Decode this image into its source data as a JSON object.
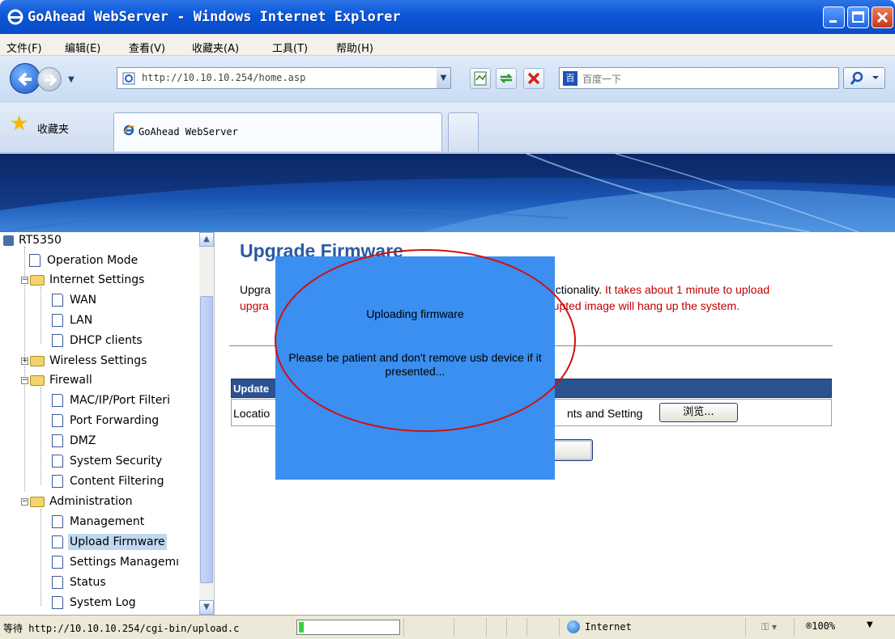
{
  "window": {
    "title": "GoAhead WebServer - Windows Internet Explorer"
  },
  "menubar": {
    "items": [
      "文件(F)",
      "编辑(E)",
      "查看(V)",
      "收藏夹(A)",
      "工具(T)",
      "帮助(H)"
    ]
  },
  "navbar": {
    "address": "http://10.10.10.254/home.asp",
    "search_placeholder": "百度一下",
    "search_logo": "百"
  },
  "favorites": {
    "label": "收藏夹",
    "tab_title": "GoAhead WebServer"
  },
  "sidebar": {
    "root": "RT5350",
    "items": [
      {
        "label": "Operation Mode"
      },
      {
        "label": "Internet Settings"
      },
      {
        "label": "WAN"
      },
      {
        "label": "LAN"
      },
      {
        "label": "DHCP clients"
      },
      {
        "label": "Wireless Settings"
      },
      {
        "label": "Firewall"
      },
      {
        "label": "MAC/IP/Port Filteri"
      },
      {
        "label": "Port Forwarding"
      },
      {
        "label": "DMZ"
      },
      {
        "label": "System Security"
      },
      {
        "label": "Content Filtering"
      },
      {
        "label": "Administration"
      },
      {
        "label": "Management"
      },
      {
        "label": "Upload Firmware"
      },
      {
        "label": "Settings Managemı"
      },
      {
        "label": "Status"
      },
      {
        "label": "System Log"
      }
    ],
    "selected": "Upload Firmware"
  },
  "main": {
    "title": "Upgrade Firmware",
    "desc_line1_left": "Upgra",
    "desc_line1_right_black": "nctionality. ",
    "desc_line1_right_red": "It takes about 1 minute to upload",
    "desc_line2_left": "upgra",
    "desc_line2_right": "rupted image will hang up the system.",
    "update_header": "Update",
    "location_label": "Locatio",
    "file_value": "nts and Setting",
    "browse_label": "浏览..."
  },
  "overlay": {
    "line1": "Uploading firmware",
    "line2": "Please be patient and don't remove usb device if it presented..."
  },
  "statusbar": {
    "text": "等待 http://10.10.10.254/cgi-bin/upload.c",
    "progress": 0.05,
    "zone": "Internet",
    "zoom": "®100%"
  },
  "colors": {
    "title_blue": "#2a5aa4",
    "warning_red": "#c00000",
    "overlay_blue": "#3a8ff0",
    "annotation_red": "#d01010"
  }
}
